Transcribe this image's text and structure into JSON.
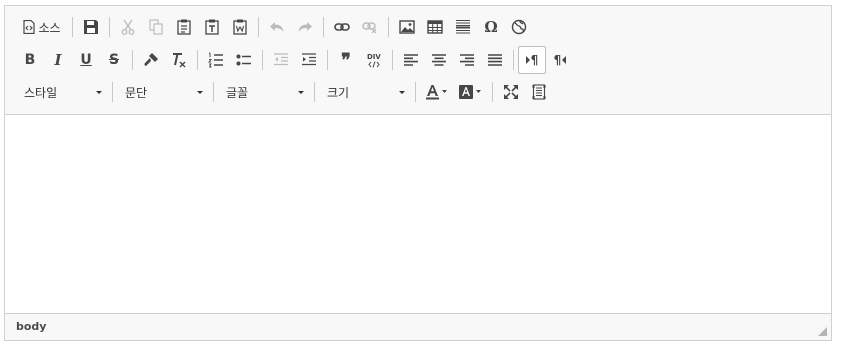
{
  "toolbar": {
    "source_label": "소스",
    "combos": {
      "style": "스타일",
      "format": "문단",
      "font": "글꼴",
      "size": "크기"
    },
    "glyphs": {
      "bold": "B",
      "italic": "I",
      "underline": "U",
      "strike": "S",
      "omega": "Ω",
      "quote": "❞",
      "pilcrow": "¶"
    }
  },
  "statusbar": {
    "path": "body"
  },
  "icons": [
    "source-icon",
    "save-icon",
    "cut-icon",
    "copy-icon",
    "paste-icon",
    "paste-text-icon",
    "paste-word-icon",
    "undo-icon",
    "redo-icon",
    "link-icon",
    "unlink-icon",
    "image-icon",
    "table-icon",
    "horizontal-rule-icon",
    "special-char-icon",
    "iframe-globe-icon",
    "bold-icon",
    "italic-icon",
    "underline-icon",
    "strike-icon",
    "copy-format-icon",
    "remove-format-icon",
    "numbered-list-icon",
    "bulleted-list-icon",
    "outdent-icon",
    "indent-icon",
    "blockquote-icon",
    "div-icon",
    "align-left-icon",
    "align-center-icon",
    "align-right-icon",
    "align-justify-icon",
    "ltr-icon",
    "rtl-icon",
    "text-color-icon",
    "bg-color-icon",
    "maximize-icon",
    "show-blocks-icon"
  ],
  "colors": {
    "toolbar_bg": "#f8f8f8",
    "border": "#d1d1d1",
    "icon": "#474747",
    "icon_disabled": "#bcbcbc"
  }
}
